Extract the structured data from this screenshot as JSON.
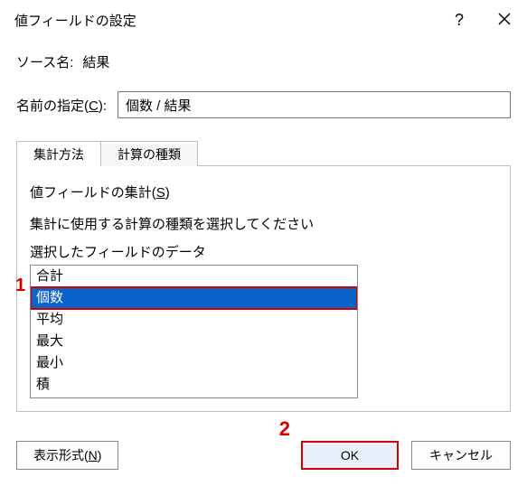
{
  "dialog": {
    "title": "値フィールドの設定",
    "help_tooltip": "?",
    "close_tooltip": "閉じる"
  },
  "source": {
    "label": "ソース名:",
    "value": "結果"
  },
  "custom_name": {
    "label_pre": "名前の指定(",
    "label_key": "C",
    "label_post": "):",
    "value": "個数 / 結果"
  },
  "tabs": [
    {
      "label": "集計方法",
      "active": true
    },
    {
      "label": "計算の種類",
      "active": false
    }
  ],
  "section": {
    "heading_pre": "値フィールドの集計(",
    "heading_key": "S",
    "heading_post": ")",
    "description": "集計に使用する計算の種類を選択してください",
    "sublabel": "選択したフィールドのデータ",
    "options": [
      "合計",
      "個数",
      "平均",
      "最大",
      "最小",
      "積"
    ],
    "selected_index": 1
  },
  "annotations": {
    "one": "1",
    "two": "2"
  },
  "buttons": {
    "number_format_pre": "表示形式(",
    "number_format_key": "N",
    "number_format_post": ")",
    "ok": "OK",
    "cancel": "キャンセル"
  }
}
